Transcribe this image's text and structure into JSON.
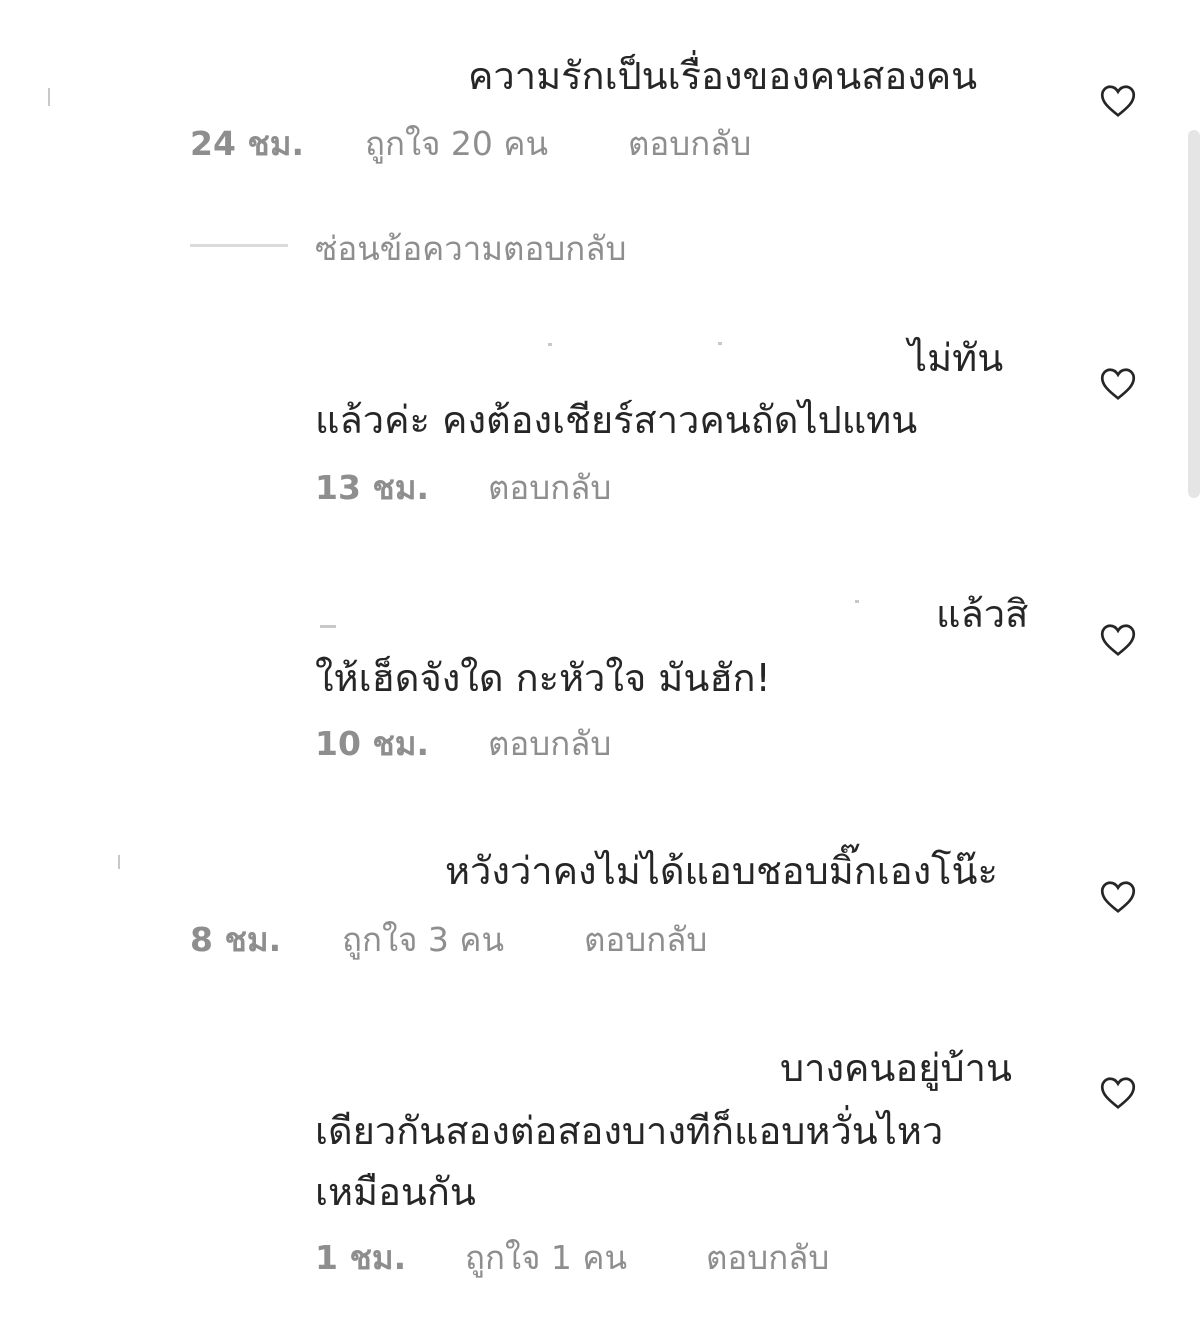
{
  "comments": [
    {
      "lines": [
        "ความรักเป็นเรื่องของคนสองคน"
      ],
      "time": "24 ชม.",
      "likes": "ถูกใจ 20 คน",
      "reply": "ตอบกลับ"
    },
    {
      "lines": [
        "ไม่ทัน",
        "แล้วค่ะ คงต้องเชียร์สาวคนถัดไปแทน"
      ],
      "time": "13 ชม.",
      "reply": "ตอบกลับ"
    },
    {
      "lines": [
        "แล้วสิ",
        "ให้เฮ็ดจังใด กะหัวใจ มันฮัก!"
      ],
      "time": "10 ชม.",
      "reply": "ตอบกลับ"
    },
    {
      "lines": [
        "หวังว่าคงไม่ได้แอบชอบมิ๊กเองโน๊ะ"
      ],
      "time": "8 ชม.",
      "likes": "ถูกใจ 3 คน",
      "reply": "ตอบกลับ"
    },
    {
      "lines": [
        "บางคนอยู่บ้าน",
        "เดียวกันสองต่อสองบางทีก็แอบหวั่นไหว",
        "เหมือนกัน"
      ],
      "time": "1 ชม.",
      "likes": "ถูกใจ 1 คน",
      "reply": "ตอบกลับ"
    }
  ],
  "hide_replies": "ซ่อนข้อความตอบกลับ",
  "icons": {
    "like": "heart-outline-icon"
  },
  "colors": {
    "text": "#262626",
    "meta": "#8e8e8e",
    "divider": "#dbdbdb"
  }
}
